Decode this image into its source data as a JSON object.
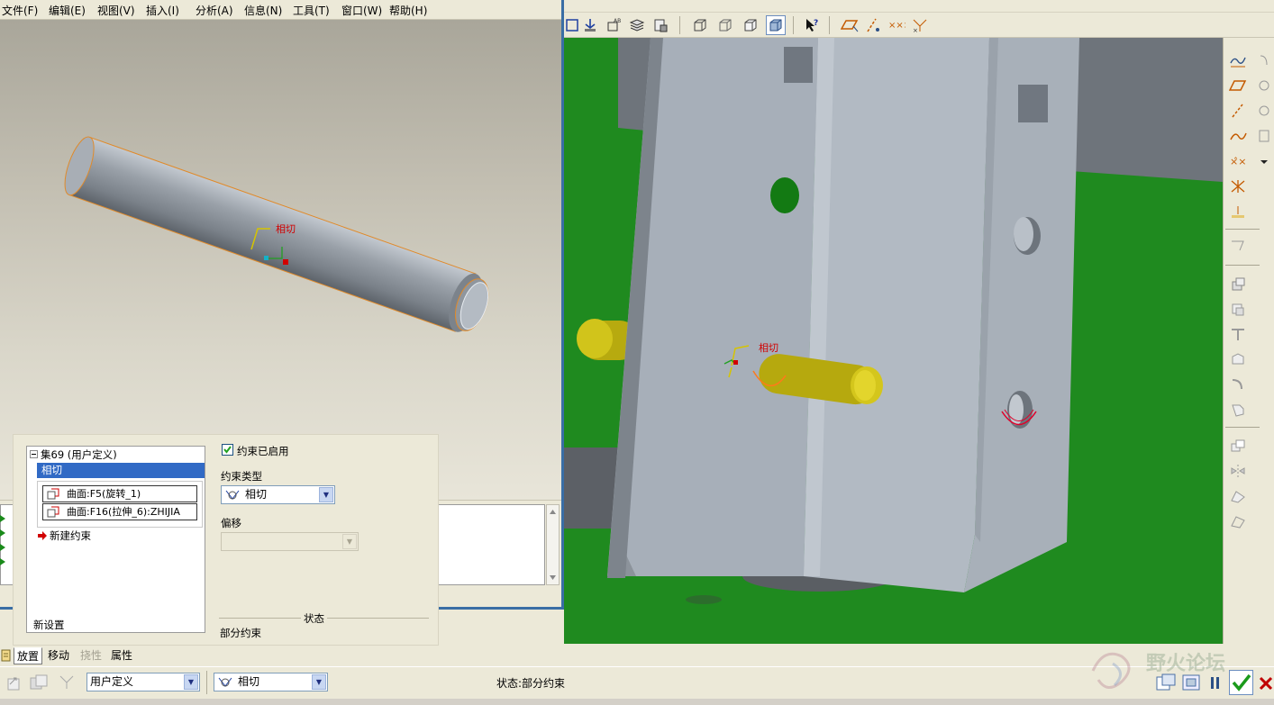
{
  "menu": {
    "file": "文件(F)",
    "edit": "编辑(E)",
    "view": "视图(V)",
    "insert": "插入(I)",
    "analysis": "分析(A)",
    "info": "信息(N)",
    "tools": "工具(T)",
    "window": "窗口(W)",
    "help": "帮助(H)"
  },
  "viewport": {
    "constraint_tag": "相切",
    "ground_color": "#1f8a1f",
    "part_color": "#a4acb6",
    "pin_color": "#cfc21a"
  },
  "sub_viewport": {
    "constraint_tag": "相切"
  },
  "placement": {
    "set_label": "集69 (用户定义)",
    "selected_constraint": "相切",
    "references": [
      "曲面:F5(旋转_1)",
      "曲面:F16(拉伸_6):ZHIJIA"
    ],
    "new_constraint": "新建约束",
    "new_set": "新设置",
    "constraint_enabled_label": "约束已启用",
    "constraint_enabled": true,
    "constraint_type_label": "约束类型",
    "constraint_type_value": "相切",
    "offset_label": "偏移",
    "offset_value": "",
    "status_label": "状态",
    "status_value": "部分约束"
  },
  "tabs": {
    "placement": "放置",
    "move": "移动",
    "flexibility": "挠性",
    "properties": "属性"
  },
  "dashboard": {
    "connection_type": "用户定义",
    "constraint_type": "相切",
    "status": "状态:部分约束"
  },
  "watermark": "野火论坛",
  "colors": {
    "accent": "#316ac5",
    "window_border": "#3a6ea5",
    "constraint_red": "#d10000",
    "ok_green": "#1a9a1a",
    "cancel_red": "#c00000"
  }
}
